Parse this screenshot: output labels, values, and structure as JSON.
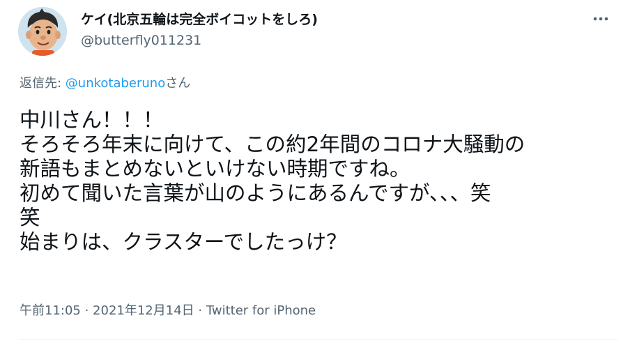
{
  "author": {
    "display_name": "ケイ(北京五輪は完全ボイコットをしろ)",
    "handle": "@butterfly011231"
  },
  "reply": {
    "prefix": "返信先: ",
    "mention": "@unkotaberuno",
    "suffix": "さん"
  },
  "tweet": {
    "lines": [
      "中川さん！！！",
      "そろそろ年末に向けて、この約2年間のコロナ大騒動の",
      "新語もまとめないといけない時期ですね。",
      "初めて聞いた言葉が山のようにあるんですが、、、笑",
      "笑",
      "始まりは、クラスターでしたっけ？"
    ]
  },
  "meta": {
    "time": "午前11:05",
    "separator": " · ",
    "date": "2021年12月14日",
    "source": "Twitter for iPhone"
  },
  "icons": {
    "avatar": "cartoon-avatar-icon",
    "more": "more-dots-icon"
  },
  "colors": {
    "text": "#0f1419",
    "secondary": "#536471",
    "accent": "#1d9bf0"
  }
}
